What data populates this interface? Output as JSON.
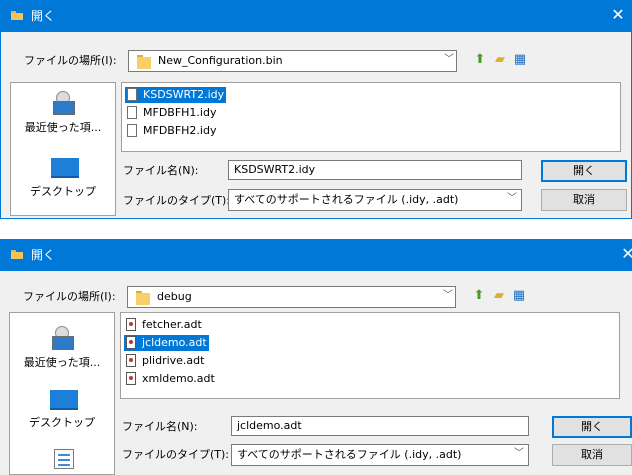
{
  "dialogs": [
    {
      "title": "開く",
      "close_glyph": "✕",
      "look_in_label": "ファイルの場所(I):",
      "look_in_value": "New_Configuration.bin",
      "places": [
        {
          "label": "最近使った項..."
        },
        {
          "label": "デスクトップ"
        }
      ],
      "files": [
        {
          "name": "KSDSWRT2.idy",
          "selected": true
        },
        {
          "name": "MFDBFH1.idy",
          "selected": false
        },
        {
          "name": "MFDBFH2.idy",
          "selected": false
        }
      ],
      "filename_label": "ファイル名(N):",
      "filename_value": "KSDSWRT2.idy",
      "filetype_label": "ファイルのタイプ(T):",
      "filetype_value": "すべてのサポートされるファイル (.idy, .adt)",
      "open_button": "開く",
      "cancel_button": "取消"
    },
    {
      "title": "開く",
      "close_glyph": "✕",
      "look_in_label": "ファイルの場所(I):",
      "look_in_value": "debug",
      "places": [
        {
          "label": "最近使った項..."
        },
        {
          "label": "デスクトップ"
        }
      ],
      "files": [
        {
          "name": "fetcher.adt",
          "selected": false
        },
        {
          "name": "jcldemo.adt",
          "selected": true
        },
        {
          "name": "plidrive.adt",
          "selected": false
        },
        {
          "name": "xmldemo.adt",
          "selected": false
        }
      ],
      "filename_label": "ファイル名(N):",
      "filename_value": "jcldemo.adt",
      "filetype_label": "ファイルのタイプ(T):",
      "filetype_value": "すべてのサポートされるファイル (.idy, .adt)",
      "open_button": "開く",
      "cancel_button": "取消"
    }
  ],
  "icons": {
    "up": "up-folder-icon",
    "new_folder": "new-folder-icon",
    "view_menu": "view-menu-icon"
  },
  "colors": {
    "titlebar": "#0078d7",
    "selection": "#0078d7"
  }
}
